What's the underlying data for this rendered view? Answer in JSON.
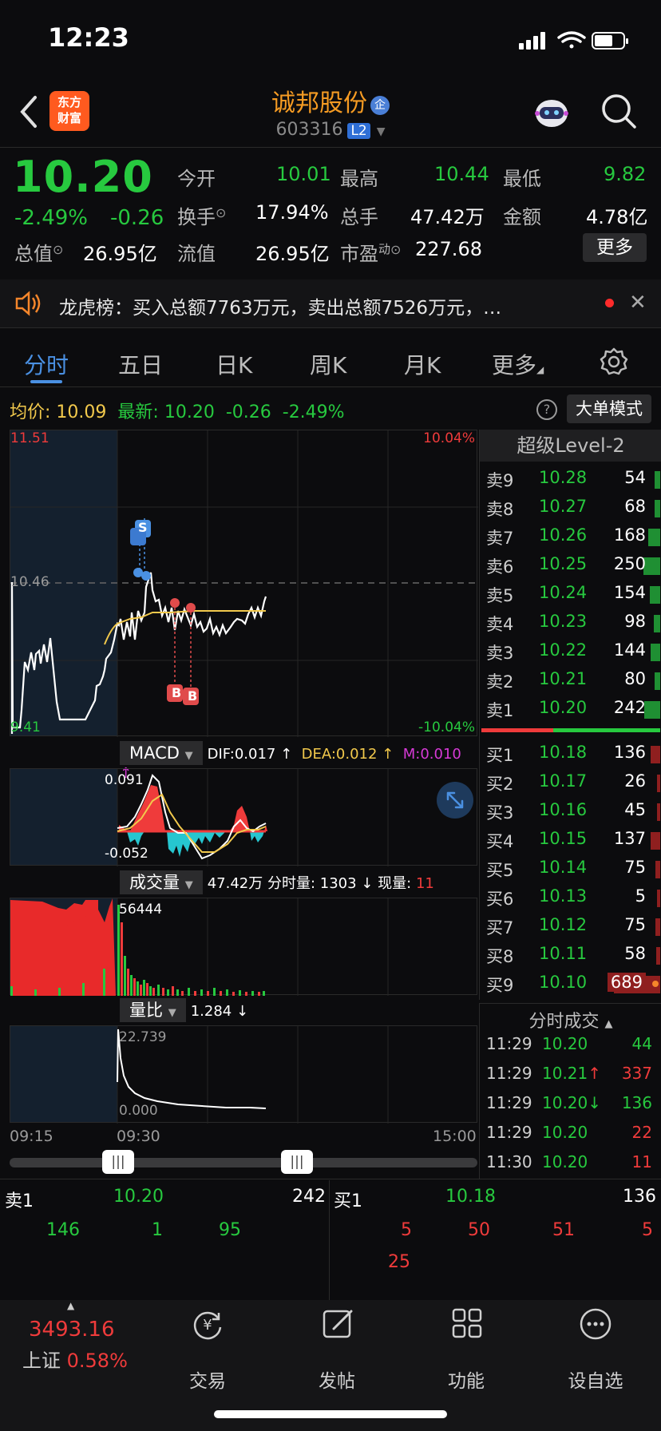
{
  "status": {
    "time": "12:23"
  },
  "header": {
    "stock_name": "诚邦股份",
    "qi_badge": "企",
    "code": "603316",
    "level_badge": "L2",
    "logo_line1": "东方",
    "logo_line2": "财富"
  },
  "quote": {
    "price": "10.20",
    "change_pct": "-2.49%",
    "change": "-0.26",
    "open_label": "今开",
    "open": "10.01",
    "high_label": "最高",
    "high": "10.44",
    "low_label": "最低",
    "low": "9.82",
    "turnover_label": "换手",
    "turnover": "17.94%",
    "volume_label": "总手",
    "volume": "47.42万",
    "amount_label": "金额",
    "amount": "4.78亿",
    "mktcap_label": "总值",
    "mktcap": "26.95亿",
    "float_label": "流值",
    "float": "26.95亿",
    "pe_label": "市盈",
    "pe_sup": "动",
    "pe": "227.68",
    "more_btn": "更多"
  },
  "notice": {
    "text": "龙虎榜：买入总额7763万元，卖出总额7526万元，…"
  },
  "tabs": [
    "分时",
    "五日",
    "日K",
    "周K",
    "月K",
    "更多"
  ],
  "summary": {
    "avg_label": "均价:",
    "avg": "10.09",
    "latest_label": "最新:",
    "latest": "10.20",
    "chg": "-0.26",
    "pct": "-2.49%",
    "mode_btn": "大单模式"
  },
  "chart": {
    "top_price": "11.51",
    "mid_price": "10.46",
    "bottom_price": "9.41",
    "top_pct": "10.04%",
    "bottom_pct": "-10.04%",
    "s_marker": "S",
    "b_marker": "B",
    "macd_label": "MACD",
    "dif": "DIF:0.017 ↑",
    "dea": "DEA:0.012 ↑",
    "m": "M:0.010 ↑",
    "macd_top": "0.091",
    "macd_bottom": "-0.052",
    "vol_label": "成交量",
    "vol_total": "47.42万",
    "vol_min_label": "分时量:",
    "vol_min": "1303 ↓",
    "vol_now_label": "现量:",
    "vol_now": "11",
    "vol_top": "56444",
    "ratio_label": "量比",
    "ratio": "1.284 ↓",
    "ratio_top": "22.739",
    "ratio_bottom": "0.000",
    "time_start": "09:15",
    "time_open": "09:30",
    "time_end": "15:00"
  },
  "orderbook": {
    "title": "超级Level-2",
    "asks": [
      {
        "n": "卖9",
        "p": "10.28",
        "v": "54",
        "bar": 0.12
      },
      {
        "n": "卖8",
        "p": "10.27",
        "v": "68",
        "bar": 0.12
      },
      {
        "n": "卖7",
        "p": "10.26",
        "v": "168",
        "bar": 0.25
      },
      {
        "n": "卖6",
        "p": "10.25",
        "v": "250",
        "bar": 0.36
      },
      {
        "n": "卖5",
        "p": "10.24",
        "v": "154",
        "bar": 0.22
      },
      {
        "n": "卖4",
        "p": "10.23",
        "v": "98",
        "bar": 0.14
      },
      {
        "n": "卖3",
        "p": "10.22",
        "v": "144",
        "bar": 0.21
      },
      {
        "n": "卖2",
        "p": "10.21",
        "v": "80",
        "bar": 0.12
      },
      {
        "n": "卖1",
        "p": "10.20",
        "v": "242",
        "bar": 0.35
      }
    ],
    "bids": [
      {
        "n": "买1",
        "p": "10.18",
        "v": "136",
        "bar": 0.2
      },
      {
        "n": "买2",
        "p": "10.17",
        "v": "26",
        "bar": 0.04
      },
      {
        "n": "买3",
        "p": "10.16",
        "v": "45",
        "bar": 0.07
      },
      {
        "n": "买4",
        "p": "10.15",
        "v": "137",
        "bar": 0.2
      },
      {
        "n": "买5",
        "p": "10.14",
        "v": "75",
        "bar": 0.11
      },
      {
        "n": "买6",
        "p": "10.13",
        "v": "5",
        "bar": 0.02
      },
      {
        "n": "买7",
        "p": "10.12",
        "v": "75",
        "bar": 0.11
      },
      {
        "n": "买8",
        "p": "10.11",
        "v": "58",
        "bar": 0.09
      },
      {
        "n": "买9",
        "p": "10.10",
        "v": "689",
        "bar": 1.0
      }
    ],
    "ticks_title": "分时成交",
    "ticks": [
      {
        "t": "11:29",
        "p": "10.20",
        "arrow": "",
        "v": "44",
        "vc": "#27c93f"
      },
      {
        "t": "11:29",
        "p": "10.21",
        "arrow": "↑",
        "v": "337",
        "vc": "#ef3b3b"
      },
      {
        "t": "11:29",
        "p": "10.20",
        "arrow": "↓",
        "v": "136",
        "vc": "#27c93f"
      },
      {
        "t": "11:29",
        "p": "10.20",
        "arrow": "",
        "v": "22",
        "vc": "#ef3b3b"
      },
      {
        "t": "11:30",
        "p": "10.20",
        "arrow": "",
        "v": "11",
        "vc": "#ef3b3b"
      }
    ]
  },
  "queue": {
    "ask_label": "卖1",
    "ask_price": "10.20",
    "ask_vol": "242",
    "bid_label": "买1",
    "bid_price": "10.18",
    "bid_vol": "136",
    "ask_orders": [
      "146",
      "1",
      "95"
    ],
    "bid_orders": [
      "5",
      "50",
      "51",
      "5",
      "25"
    ]
  },
  "nav": {
    "index_value": "3493.16",
    "index_name": "上证",
    "index_pct": "0.58%",
    "items": [
      "交易",
      "发帖",
      "功能",
      "设自选"
    ]
  },
  "colors": {
    "up": "#ef3b3b",
    "down": "#27c93f",
    "accent": "#4a90e2",
    "avg": "#f2c94c"
  }
}
